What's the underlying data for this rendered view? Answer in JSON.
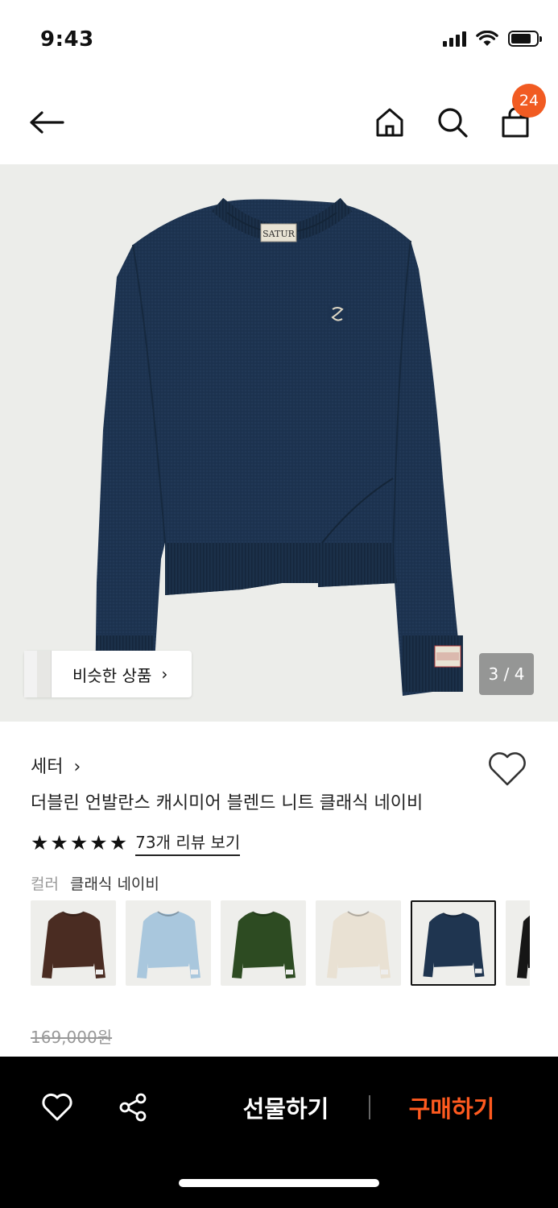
{
  "status": {
    "time": "9:43"
  },
  "header": {
    "cart_count": "24"
  },
  "gallery": {
    "similar_label": "비슷한 상품",
    "page_indicator": "3 / 4",
    "current_page": 3,
    "total_pages": 4,
    "main_color": "#1d3350",
    "brand_tag": "SATUR"
  },
  "product": {
    "category": "세터",
    "title": "더블린 언발란스 캐시미어 블렌드 니트 클래식 네이비",
    "rating": 5,
    "review_link": "73개 리뷰 보기",
    "color_label": "컬러",
    "color_value": "클래식 네이비",
    "original_price": "169,000원"
  },
  "swatches": [
    {
      "name": "brown",
      "color": "#4a2c22",
      "selected": false
    },
    {
      "name": "light-blue",
      "color": "#a9c7dd",
      "selected": false
    },
    {
      "name": "green",
      "color": "#2d4b22",
      "selected": false
    },
    {
      "name": "cream",
      "color": "#e9e1d3",
      "selected": false
    },
    {
      "name": "navy",
      "color": "#1f3550",
      "selected": true
    },
    {
      "name": "black",
      "color": "#161616",
      "selected": false
    }
  ],
  "bottom_bar": {
    "gift_label": "선물하기",
    "buy_label": "구매하기"
  },
  "colors": {
    "accent": "#f15b22",
    "buy": "#ff5a1f"
  }
}
